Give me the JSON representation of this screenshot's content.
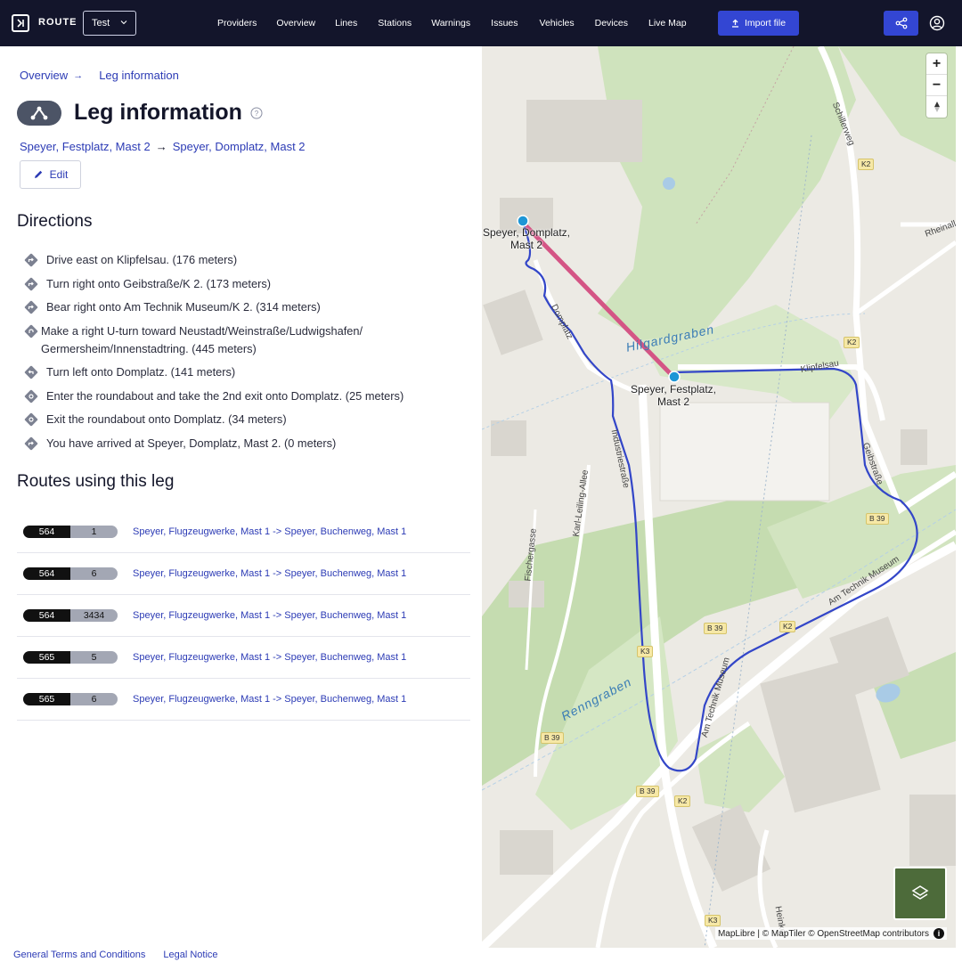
{
  "app": {
    "logo_text": "ROUTE",
    "environment": "Test",
    "nav": [
      "Providers",
      "Overview",
      "Lines",
      "Stations",
      "Warnings",
      "Issues",
      "Vehicles",
      "Devices",
      "Live Map"
    ],
    "import_label": "Import file",
    "accent": "#3346d3",
    "nav_bg": "#13152b"
  },
  "breadcrumb": {
    "parent": "Overview",
    "current": "Leg information"
  },
  "page": {
    "title": "Leg information",
    "from_stop": "Speyer, Festplatz, Mast 2",
    "to_stop": "Speyer, Domplatz, Mast 2",
    "edit_label": "Edit"
  },
  "directions": {
    "heading": "Directions",
    "steps": [
      "Drive east on Klipfelsau. (176 meters)",
      "Turn right onto Geibstraße/K 2. (173 meters)",
      "Bear right onto Am Technik Museum/K 2. (314 meters)",
      "Make a right U-turn toward Neustadt/Weinstraße/Ludwigshafen/ Germersheim/Innenstadtring. (445 meters)",
      "Turn left onto Domplatz. (141 meters)",
      "Enter the roundabout and take the 2nd exit onto Domplatz. (25 meters)",
      "Exit the roundabout onto Domplatz. (34 meters)",
      "You have arrived at Speyer, Domplatz, Mast 2. (0 meters)"
    ]
  },
  "routes": {
    "heading": "Routes using this leg",
    "rows": [
      {
        "line": "564",
        "variant": "1",
        "label": "Speyer, Flugzeugwerke, Mast 1 -> Speyer, Buchenweg, Mast 1"
      },
      {
        "line": "564",
        "variant": "6",
        "label": "Speyer, Flugzeugwerke, Mast 1 -> Speyer, Buchenweg, Mast 1"
      },
      {
        "line": "564",
        "variant": "3434",
        "label": "Speyer, Flugzeugwerke, Mast 1 -> Speyer, Buchenweg, Mast 1"
      },
      {
        "line": "565",
        "variant": "5",
        "label": "Speyer, Flugzeugwerke, Mast 1 -> Speyer, Buchenweg, Mast 1"
      },
      {
        "line": "565",
        "variant": "6",
        "label": "Speyer, Flugzeugwerke, Mast 1 -> Speyer, Buchenweg, Mast 1"
      }
    ]
  },
  "footer": {
    "terms": "General Terms and Conditions",
    "legal": "Legal Notice"
  },
  "map": {
    "stop_a": "Speyer, Domplatz, Mast 2",
    "stop_b": "Speyer, Festplatz, Mast 2",
    "streets": [
      "Schillerweg",
      "Rheinallee",
      "Domplatz",
      "Klipfelsau",
      "Geibstraße",
      "Industriestraße",
      "Karl-Leiling-Allee",
      "Fischergasse",
      "Am Technik Museum",
      "Heinkel"
    ],
    "water": [
      "Hilgardgraben",
      "Renngraben"
    ],
    "road_tags": [
      "K2",
      "K3",
      "B 39"
    ],
    "attribution": "MapLibre | © MapTiler © OpenStreetMap contributors",
    "route_color": "#3346c8",
    "straight_color": "#d45585"
  }
}
